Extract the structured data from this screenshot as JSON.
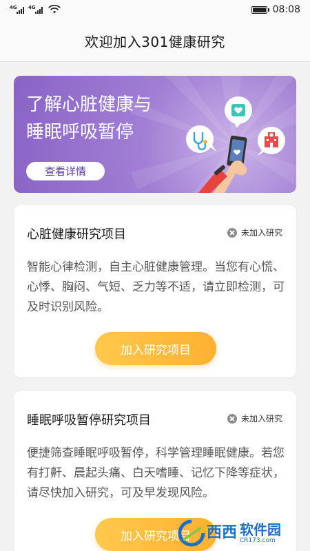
{
  "status_bar": {
    "signal1": "4G",
    "signal2": "4G",
    "time": "08:08"
  },
  "header": {
    "title": "欢迎加入301健康研究"
  },
  "banner": {
    "title_line1": "了解心脏健康与",
    "title_line2": "睡眠呼吸暂停",
    "button_label": "查看详情",
    "bg_color": "#8a63c6"
  },
  "cards": [
    {
      "title": "心脏健康研究项目",
      "status": "未加入研究",
      "description": "智能心律检测，自主心脏健康管理。当您有心慌、心悸、胸闷、气短、乏力等不适，请立即检测，可及时识别风险。",
      "button_label": "加入研究项目"
    },
    {
      "title": "睡眠呼吸暂停研究项目",
      "status": "未加入研究",
      "description": "便捷筛查睡眠呼吸暂停，科学管理睡眠健康。若您有打鼾、晨起头痛、白天嗜睡、记忆下降等症状，请尽快加入研究，可及早发现风险。",
      "button_label": "加入研究项目"
    }
  ],
  "watermark": {
    "text": "西西",
    "brand": "软件园",
    "domain": "CR173.com"
  },
  "colors": {
    "accent": "#ffb030",
    "banner": "#8a63c6",
    "text_secondary": "#555555"
  }
}
